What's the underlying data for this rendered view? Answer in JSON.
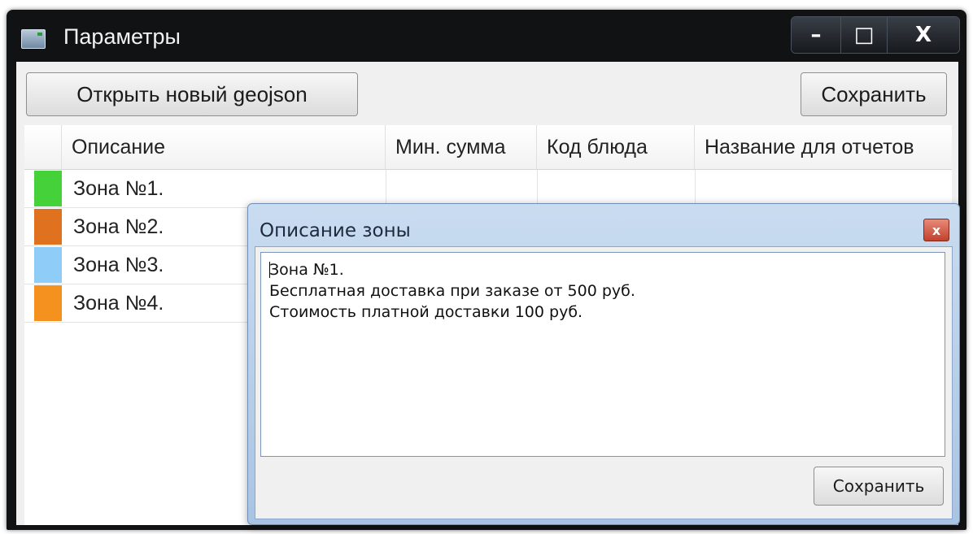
{
  "window": {
    "title": "Параметры",
    "controls": {
      "minimize": "–",
      "maximize": "□",
      "close": "X"
    }
  },
  "toolbar": {
    "open_label": "Открыть новый geojson",
    "save_label": "Сохранить"
  },
  "table": {
    "columns": [
      "Описание",
      "Мин. сумма",
      "Код блюда",
      "Название для отчетов"
    ],
    "rows": [
      {
        "color": "#44d13a",
        "description": "Зона №1."
      },
      {
        "color": "#e0711f",
        "description": "Зона №2."
      },
      {
        "color": "#8fcdf8",
        "description": "Зона №3."
      },
      {
        "color": "#f5911e",
        "description": "Зона №4."
      }
    ]
  },
  "dialog": {
    "title": "Описание зоны",
    "close_label": "x",
    "text_lines": [
      "Зона №1.",
      "Бесплатная доставка при заказе от 500 руб.",
      "Стоимость платной доставки 100 руб."
    ],
    "save_label": "Сохранить"
  }
}
